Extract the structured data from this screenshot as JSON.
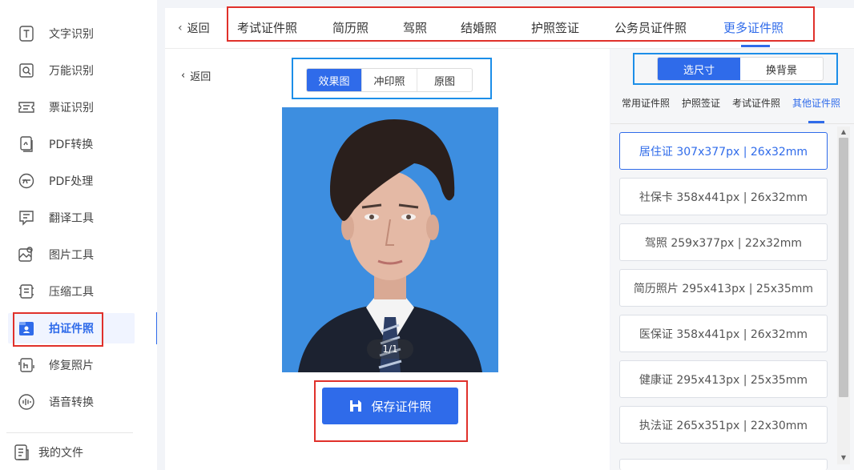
{
  "sidebar": {
    "items": [
      {
        "label": "文字识别",
        "icon": "text-recognition-icon"
      },
      {
        "label": "万能识别",
        "icon": "universal-recognition-icon"
      },
      {
        "label": "票证识别",
        "icon": "ticket-recognition-icon"
      },
      {
        "label": "PDF转换",
        "icon": "pdf-convert-icon"
      },
      {
        "label": "PDF处理",
        "icon": "pdf-process-icon"
      },
      {
        "label": "翻译工具",
        "icon": "translate-icon"
      },
      {
        "label": "图片工具",
        "icon": "image-tools-icon"
      },
      {
        "label": "压缩工具",
        "icon": "compress-icon"
      },
      {
        "label": "拍证件照",
        "icon": "id-photo-icon",
        "active": true
      },
      {
        "label": "修复照片",
        "icon": "repair-photo-icon"
      },
      {
        "label": "语音转换",
        "icon": "voice-convert-icon"
      }
    ],
    "my_files": {
      "label": "我的文件",
      "icon": "my-files-icon"
    }
  },
  "topbar": {
    "back_label": "返回",
    "tabs": [
      "考试证件照",
      "简历照",
      "驾照",
      "结婚照",
      "护照签证",
      "公务员证件照",
      "更多证件照"
    ],
    "active_tab": "更多证件照"
  },
  "preview": {
    "back_label": "返回",
    "view_modes": [
      "效果图",
      "冲印照",
      "原图"
    ],
    "active_view": "效果图",
    "pager": "1/1",
    "save_label": "保存证件照"
  },
  "right_panel": {
    "modes": [
      "选尺寸",
      "换背景"
    ],
    "active_mode": "选尺寸",
    "categories": [
      "常用证件照",
      "护照签证",
      "考试证件照",
      "其他证件照"
    ],
    "active_category": "其他证件照",
    "sizes": [
      "居住证 307x377px | 26x32mm",
      "社保卡 358x441px | 26x32mm",
      "驾照 259x377px | 22x32mm",
      "简历照片 295x413px | 25x35mm",
      "医保证 358x441px | 26x32mm",
      "健康证 295x413px | 25x35mm",
      "执法证 265x351px | 22x30mm"
    ],
    "selected_size": "居住证 307x377px | 26x32mm"
  },
  "colors": {
    "accent": "#2f6bea",
    "photo_background": "#3d8ee0",
    "highlight_red": "#e0312b",
    "highlight_blue": "#1c8ee8"
  }
}
